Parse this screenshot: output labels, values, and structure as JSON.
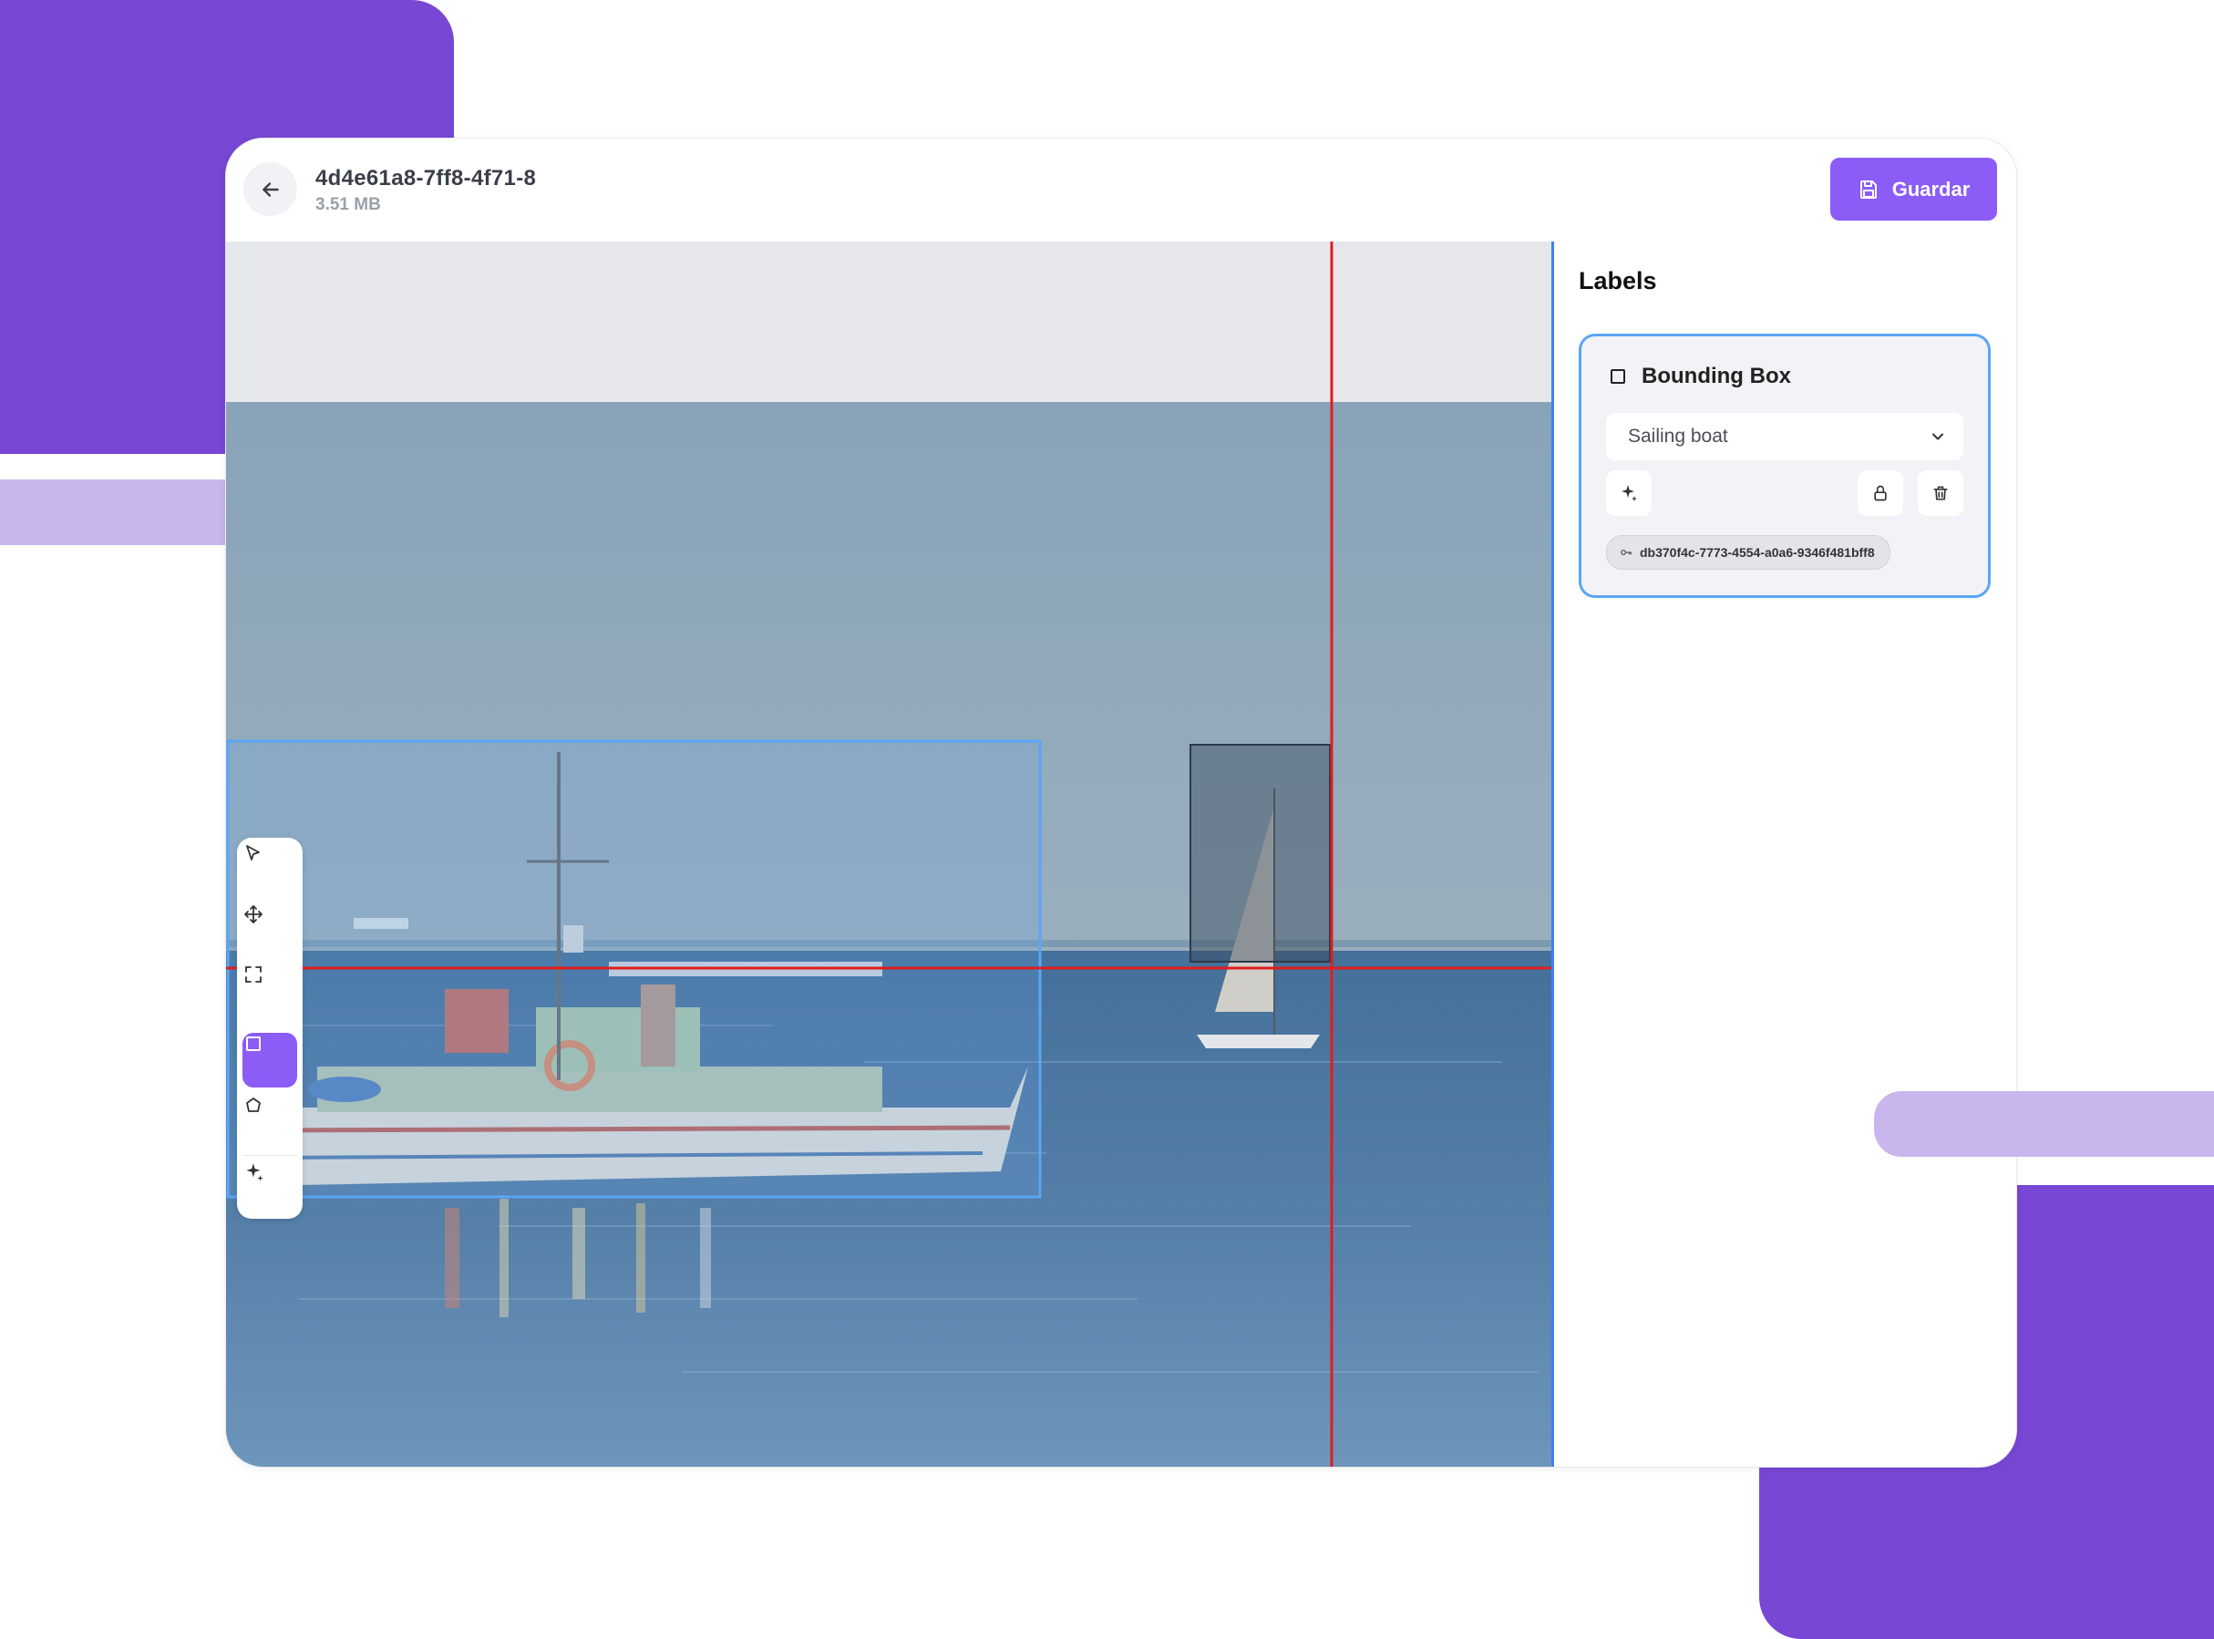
{
  "header": {
    "file_name": "4d4e61a8-7ff8-4f71-8",
    "file_size": "3.51 MB",
    "save_label": "Guardar"
  },
  "toolbar": {
    "tools": [
      "pointer-tool",
      "move-tool",
      "fit-tool",
      "bounding-box-tool",
      "polygon-tool",
      "ai-magic-tool"
    ],
    "active_tool": "bounding-box-tool"
  },
  "sidebar": {
    "title": "Labels",
    "label_card": {
      "type": "Bounding Box",
      "class_selected": "Sailing boat",
      "id": "db370f4c-7773-4554-a0a6-9346f481bff8"
    }
  },
  "colors": {
    "accent": "#8b5cf6",
    "selection": "#5aa6f5",
    "crosshair": "#e11d1d",
    "decor": "#7847d4"
  }
}
